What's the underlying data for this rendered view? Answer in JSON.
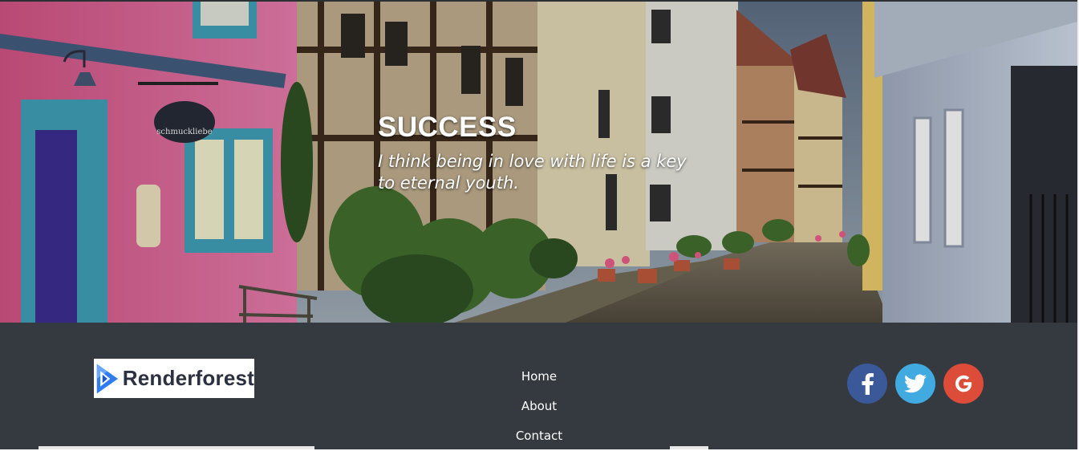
{
  "hero": {
    "title": "SUCCESS",
    "quote": "I think being in love with life is a key to eternal youth.",
    "sign_text": "schmuckliebe"
  },
  "footer": {
    "logo_text": "Renderforest",
    "nav": [
      {
        "label": "Home"
      },
      {
        "label": "About"
      },
      {
        "label": "Contact"
      }
    ],
    "social": [
      {
        "name": "facebook",
        "glyph": "f"
      },
      {
        "name": "twitter",
        "glyph": "twitter-bird"
      },
      {
        "name": "google",
        "glyph": "G"
      }
    ]
  },
  "colors": {
    "footer_bg": "#343a40",
    "facebook": "#3b5998",
    "twitter": "#41abe1",
    "google": "#dd4b39"
  }
}
